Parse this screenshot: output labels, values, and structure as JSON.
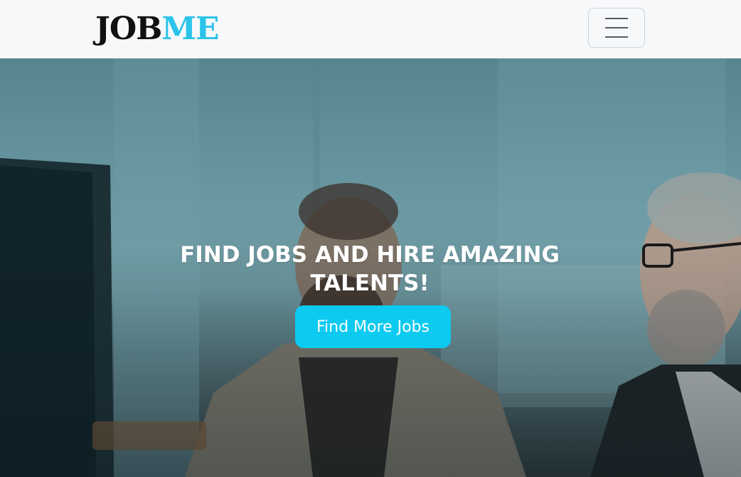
{
  "navbar": {
    "logo_part1": "JOB",
    "logo_part2": "ME",
    "toggler_icon": "hamburger-menu-icon"
  },
  "hero": {
    "headline": "FIND JOBS AND HIRE AMAZING TALENTS!",
    "cta_label": "Find More Jobs"
  },
  "colors": {
    "brand_accent": "#2cc3ea",
    "button_bg": "#0dcaf0",
    "navbar_bg": "#f7f8fa"
  }
}
